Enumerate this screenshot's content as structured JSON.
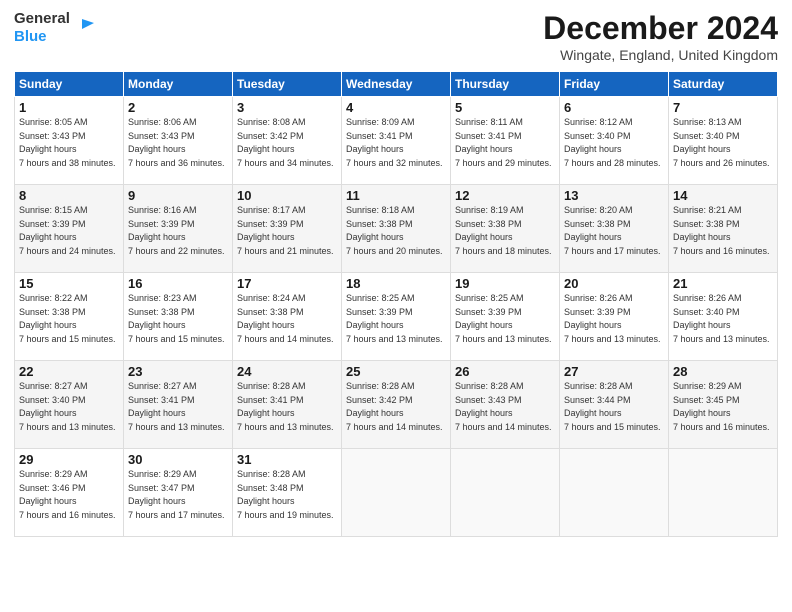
{
  "logo": {
    "line1": "General",
    "line2": "Blue"
  },
  "title": "December 2024",
  "subtitle": "Wingate, England, United Kingdom",
  "headers": [
    "Sunday",
    "Monday",
    "Tuesday",
    "Wednesday",
    "Thursday",
    "Friday",
    "Saturday"
  ],
  "weeks": [
    [
      {
        "day": "1",
        "sunrise": "8:05 AM",
        "sunset": "3:43 PM",
        "daylight": "7 hours and 38 minutes."
      },
      {
        "day": "2",
        "sunrise": "8:06 AM",
        "sunset": "3:43 PM",
        "daylight": "7 hours and 36 minutes."
      },
      {
        "day": "3",
        "sunrise": "8:08 AM",
        "sunset": "3:42 PM",
        "daylight": "7 hours and 34 minutes."
      },
      {
        "day": "4",
        "sunrise": "8:09 AM",
        "sunset": "3:41 PM",
        "daylight": "7 hours and 32 minutes."
      },
      {
        "day": "5",
        "sunrise": "8:11 AM",
        "sunset": "3:41 PM",
        "daylight": "7 hours and 29 minutes."
      },
      {
        "day": "6",
        "sunrise": "8:12 AM",
        "sunset": "3:40 PM",
        "daylight": "7 hours and 28 minutes."
      },
      {
        "day": "7",
        "sunrise": "8:13 AM",
        "sunset": "3:40 PM",
        "daylight": "7 hours and 26 minutes."
      }
    ],
    [
      {
        "day": "8",
        "sunrise": "8:15 AM",
        "sunset": "3:39 PM",
        "daylight": "7 hours and 24 minutes."
      },
      {
        "day": "9",
        "sunrise": "8:16 AM",
        "sunset": "3:39 PM",
        "daylight": "7 hours and 22 minutes."
      },
      {
        "day": "10",
        "sunrise": "8:17 AM",
        "sunset": "3:39 PM",
        "daylight": "7 hours and 21 minutes."
      },
      {
        "day": "11",
        "sunrise": "8:18 AM",
        "sunset": "3:38 PM",
        "daylight": "7 hours and 20 minutes."
      },
      {
        "day": "12",
        "sunrise": "8:19 AM",
        "sunset": "3:38 PM",
        "daylight": "7 hours and 18 minutes."
      },
      {
        "day": "13",
        "sunrise": "8:20 AM",
        "sunset": "3:38 PM",
        "daylight": "7 hours and 17 minutes."
      },
      {
        "day": "14",
        "sunrise": "8:21 AM",
        "sunset": "3:38 PM",
        "daylight": "7 hours and 16 minutes."
      }
    ],
    [
      {
        "day": "15",
        "sunrise": "8:22 AM",
        "sunset": "3:38 PM",
        "daylight": "7 hours and 15 minutes."
      },
      {
        "day": "16",
        "sunrise": "8:23 AM",
        "sunset": "3:38 PM",
        "daylight": "7 hours and 15 minutes."
      },
      {
        "day": "17",
        "sunrise": "8:24 AM",
        "sunset": "3:38 PM",
        "daylight": "7 hours and 14 minutes."
      },
      {
        "day": "18",
        "sunrise": "8:25 AM",
        "sunset": "3:39 PM",
        "daylight": "7 hours and 13 minutes."
      },
      {
        "day": "19",
        "sunrise": "8:25 AM",
        "sunset": "3:39 PM",
        "daylight": "7 hours and 13 minutes."
      },
      {
        "day": "20",
        "sunrise": "8:26 AM",
        "sunset": "3:39 PM",
        "daylight": "7 hours and 13 minutes."
      },
      {
        "day": "21",
        "sunrise": "8:26 AM",
        "sunset": "3:40 PM",
        "daylight": "7 hours and 13 minutes."
      }
    ],
    [
      {
        "day": "22",
        "sunrise": "8:27 AM",
        "sunset": "3:40 PM",
        "daylight": "7 hours and 13 minutes."
      },
      {
        "day": "23",
        "sunrise": "8:27 AM",
        "sunset": "3:41 PM",
        "daylight": "7 hours and 13 minutes."
      },
      {
        "day": "24",
        "sunrise": "8:28 AM",
        "sunset": "3:41 PM",
        "daylight": "7 hours and 13 minutes."
      },
      {
        "day": "25",
        "sunrise": "8:28 AM",
        "sunset": "3:42 PM",
        "daylight": "7 hours and 14 minutes."
      },
      {
        "day": "26",
        "sunrise": "8:28 AM",
        "sunset": "3:43 PM",
        "daylight": "7 hours and 14 minutes."
      },
      {
        "day": "27",
        "sunrise": "8:28 AM",
        "sunset": "3:44 PM",
        "daylight": "7 hours and 15 minutes."
      },
      {
        "day": "28",
        "sunrise": "8:29 AM",
        "sunset": "3:45 PM",
        "daylight": "7 hours and 16 minutes."
      }
    ],
    [
      {
        "day": "29",
        "sunrise": "8:29 AM",
        "sunset": "3:46 PM",
        "daylight": "7 hours and 16 minutes."
      },
      {
        "day": "30",
        "sunrise": "8:29 AM",
        "sunset": "3:47 PM",
        "daylight": "7 hours and 17 minutes."
      },
      {
        "day": "31",
        "sunrise": "8:28 AM",
        "sunset": "3:48 PM",
        "daylight": "7 hours and 19 minutes."
      },
      null,
      null,
      null,
      null
    ]
  ],
  "labels": {
    "sunrise": "Sunrise:",
    "sunset": "Sunset:",
    "daylight": "Daylight hours"
  }
}
